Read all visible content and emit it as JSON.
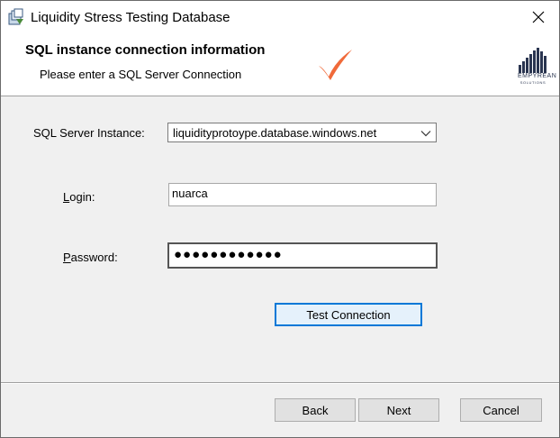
{
  "window": {
    "title": "Liquidity Stress Testing Database"
  },
  "header": {
    "title": "SQL instance connection information",
    "subtitle": "Please enter a SQL Server Connection",
    "logo_text": "EMPYREAN",
    "logo_subtext": "SOLUTIONS"
  },
  "form": {
    "sql_instance_label": "SQL Server Instance:",
    "sql_instance_value": "liquidityprotoype.database.windows.net",
    "login_label_accel": "L",
    "login_label_rest": "ogin:",
    "login_value": "nuarca",
    "password_label_accel": "P",
    "password_label_rest": "assword:",
    "password_value": "●●●●●●●●●●●●",
    "test_connection_label": "Test Connection"
  },
  "footer": {
    "back_label": "Back",
    "next_label": "Next",
    "cancel_label": "Cancel"
  },
  "colors": {
    "accent": "#0078d7",
    "checkmark": "#f06a3a",
    "logo": "#2a3550"
  }
}
